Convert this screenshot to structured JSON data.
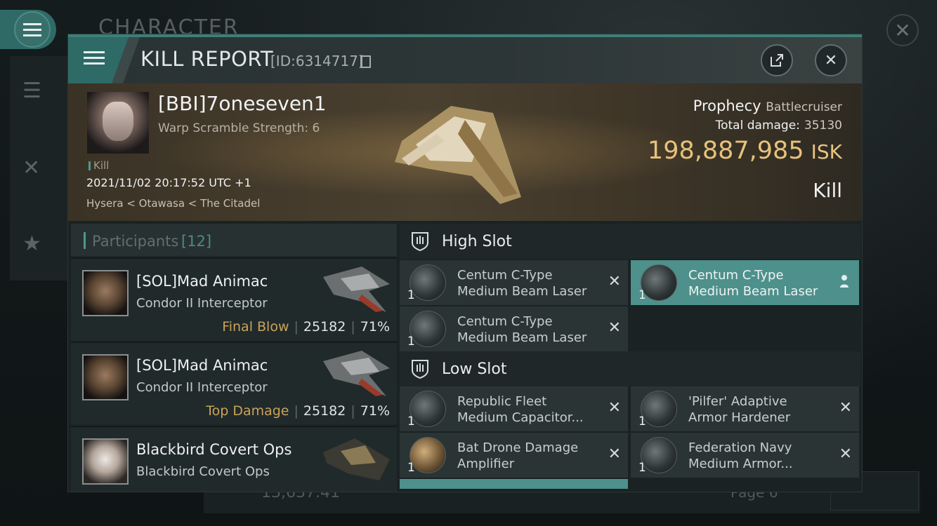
{
  "background": {
    "title": "CHARACTER",
    "isk_value": "13,637.41",
    "page_label": "Page 6"
  },
  "header": {
    "title": "KILL REPORT",
    "id_label": "[ID:6314717]"
  },
  "victim": {
    "name": "[BBI]7oneseven1",
    "warp_scramble": "Warp Scramble Strength: 6",
    "kill_tag": "Kill",
    "datetime": "2021/11/02 20:17:52 UTC +1",
    "location": "Hysera < Otawasa < The Citadel",
    "ship_name": "Prophecy",
    "ship_class": "Battlecruiser",
    "total_damage_label": "Total damage:",
    "total_damage_value": "35130",
    "isk_value": "198,887,985",
    "isk_unit": "ISK",
    "kill_type": "Kill"
  },
  "participants": {
    "title": "Participants",
    "count": "[12]",
    "rows": [
      {
        "name": "[SOL]Mad Animac",
        "ship": "Condor II Interceptor",
        "tag": "Final Blow",
        "damage": "25182",
        "percent": "71%"
      },
      {
        "name": "[SOL]Mad Animac",
        "ship": "Condor II Interceptor",
        "tag": "Top Damage",
        "damage": "25182",
        "percent": "71%"
      },
      {
        "name": "Blackbird Covert Ops",
        "ship": "Blackbird Covert Ops",
        "tag": "",
        "damage": "",
        "percent": ""
      }
    ]
  },
  "slots": {
    "high": {
      "title": "High Slot",
      "items": [
        {
          "qty": "1",
          "line1": "Centum C-Type",
          "line2": "Medium Beam Laser"
        },
        {
          "qty": "1",
          "line1": "Centum C-Type",
          "line2": "Medium Beam Laser"
        },
        {
          "qty": "1",
          "line1": "Centum C-Type",
          "line2": "Medium Beam Laser"
        }
      ]
    },
    "low": {
      "title": "Low Slot",
      "items": [
        {
          "qty": "1",
          "line1": "Republic Fleet",
          "line2": "Medium Capacitor..."
        },
        {
          "qty": "1",
          "line1": "'Pilfer' Adaptive",
          "line2": "Armor Hardener"
        },
        {
          "qty": "1",
          "line1": "Bat Drone Damage",
          "line2": "Amplifier"
        },
        {
          "qty": "1",
          "line1": "Federation Navy",
          "line2": "Medium Armor..."
        }
      ]
    }
  },
  "colors": {
    "accent": "#4e908b",
    "isk_gold": "#e6c27c",
    "tag_gold": "#c9a35a"
  }
}
